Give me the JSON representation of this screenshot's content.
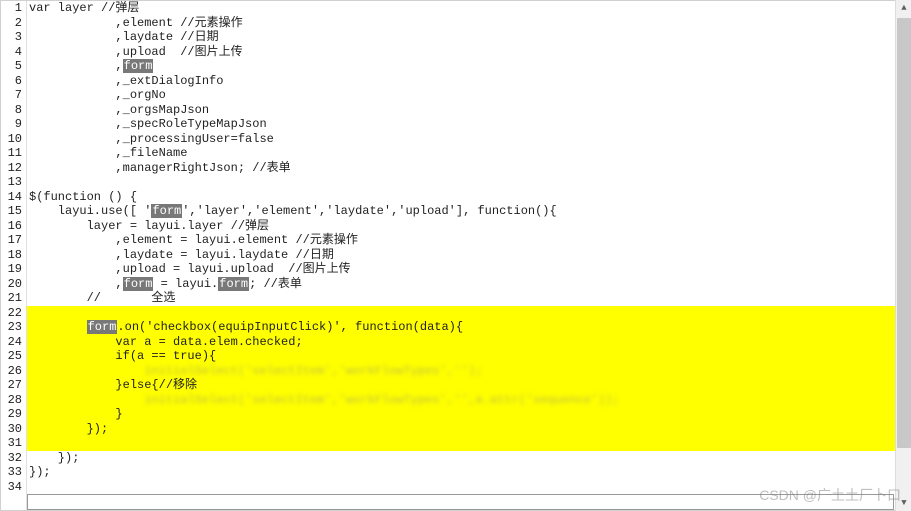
{
  "lines": [
    {
      "n": 1,
      "segs": [
        {
          "t": "var layer //弹层"
        }
      ]
    },
    {
      "n": 2,
      "segs": [
        {
          "t": "            ,element //元素操作"
        }
      ]
    },
    {
      "n": 3,
      "segs": [
        {
          "t": "            ,laydate //日期"
        }
      ]
    },
    {
      "n": 4,
      "segs": [
        {
          "t": "            ,upload  //图片上传"
        }
      ]
    },
    {
      "n": 5,
      "segs": [
        {
          "t": "            ,"
        },
        {
          "t": "form",
          "hl": true
        }
      ]
    },
    {
      "n": 6,
      "segs": [
        {
          "t": "            ,_extDialogInfo"
        }
      ]
    },
    {
      "n": 7,
      "segs": [
        {
          "t": "            ,_orgNo"
        }
      ]
    },
    {
      "n": 8,
      "segs": [
        {
          "t": "            ,_orgsMapJson"
        }
      ]
    },
    {
      "n": 9,
      "segs": [
        {
          "t": "            ,_specRoleTypeMapJson"
        }
      ]
    },
    {
      "n": 10,
      "segs": [
        {
          "t": "            ,_processingUser=false"
        }
      ]
    },
    {
      "n": 11,
      "segs": [
        {
          "t": "            ,_fileName"
        }
      ]
    },
    {
      "n": 12,
      "segs": [
        {
          "t": "            ,managerRightJson; //表单"
        }
      ]
    },
    {
      "n": 13,
      "segs": [
        {
          "t": ""
        }
      ]
    },
    {
      "n": 14,
      "segs": [
        {
          "t": "$(function () {"
        }
      ]
    },
    {
      "n": 15,
      "segs": [
        {
          "t": "    layui.use([ '"
        },
        {
          "t": "form",
          "hl": true
        },
        {
          "t": "','layer','element','laydate','upload'], function(){"
        }
      ]
    },
    {
      "n": 16,
      "segs": [
        {
          "t": "        layer = layui.layer //弹层"
        }
      ]
    },
    {
      "n": 17,
      "segs": [
        {
          "t": "            ,element = layui.element //元素操作"
        }
      ]
    },
    {
      "n": 18,
      "segs": [
        {
          "t": "            ,laydate = layui.laydate //日期"
        }
      ]
    },
    {
      "n": 19,
      "segs": [
        {
          "t": "            ,upload = layui.upload  //图片上传"
        }
      ]
    },
    {
      "n": 20,
      "segs": [
        {
          "t": "            ,"
        },
        {
          "t": "form",
          "hl": true
        },
        {
          "t": " = layui."
        },
        {
          "t": "form",
          "hl": true
        },
        {
          "t": "; //表单"
        }
      ]
    },
    {
      "n": 21,
      "segs": [
        {
          "t": "        //       全选"
        }
      ]
    },
    {
      "n": 22,
      "segs": [
        {
          "t": ""
        }
      ],
      "bg": "y"
    },
    {
      "n": 23,
      "segs": [
        {
          "t": "        "
        },
        {
          "t": "form",
          "hl": true
        },
        {
          "t": ".on('checkbox(equipInputClick)', function(data){"
        }
      ],
      "bg": "y"
    },
    {
      "n": 24,
      "segs": [
        {
          "t": "            var a = data.elem.checked;"
        }
      ],
      "bg": "y"
    },
    {
      "n": 25,
      "segs": [
        {
          "t": "            if(a == true){"
        }
      ],
      "bg": "y"
    },
    {
      "n": 26,
      "segs": [
        {
          "t": "                "
        },
        {
          "t": "initialSelect('selectItem','workFlowTypes','');",
          "blur": true
        }
      ],
      "bg": "y"
    },
    {
      "n": 27,
      "segs": [
        {
          "t": "            }else{//移除"
        }
      ],
      "bg": "y"
    },
    {
      "n": 28,
      "segs": [
        {
          "t": "                "
        },
        {
          "t": "initialSelect('selectItem','workFlowTypes','',a.attr('sequence'));",
          "blur": true
        }
      ],
      "bg": "y"
    },
    {
      "n": 29,
      "segs": [
        {
          "t": "            }"
        }
      ],
      "bg": "y"
    },
    {
      "n": 30,
      "segs": [
        {
          "t": "        });"
        }
      ],
      "bg": "y"
    },
    {
      "n": 31,
      "segs": [
        {
          "t": ""
        }
      ],
      "bg": "y"
    },
    {
      "n": 32,
      "segs": [
        {
          "t": "    });"
        }
      ]
    },
    {
      "n": 33,
      "segs": [
        {
          "t": "});"
        }
      ]
    },
    {
      "n": 34,
      "segs": [
        {
          "t": ""
        }
      ]
    }
  ],
  "watermark": "CSDN @广土土厂卜口",
  "scroll": {
    "up": "▲",
    "down": "▼"
  }
}
